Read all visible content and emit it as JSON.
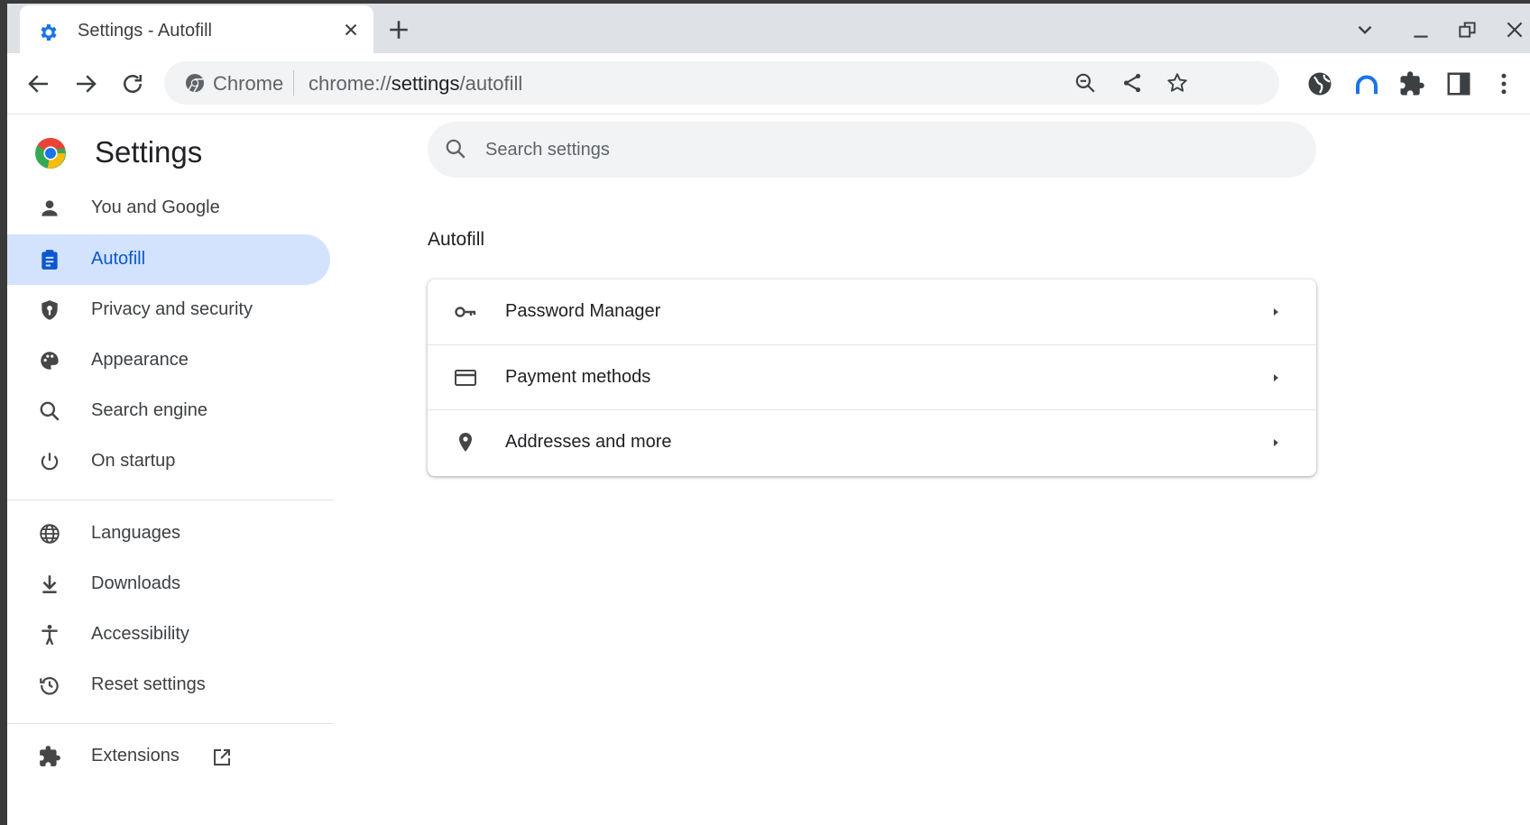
{
  "browser": {
    "tab_title": "Settings - Autofill",
    "omnibox": {
      "chip_label": "Chrome",
      "url_scheme": "chrome://",
      "url_host": "settings",
      "url_path": "/autofill"
    }
  },
  "sidebar": {
    "title": "Settings",
    "items": [
      {
        "label": "You and Google",
        "icon": "person-icon"
      },
      {
        "label": "Autofill",
        "icon": "clipboard-icon",
        "active": true
      },
      {
        "label": "Privacy and security",
        "icon": "shield-icon"
      },
      {
        "label": "Appearance",
        "icon": "palette-icon"
      },
      {
        "label": "Search engine",
        "icon": "search-icon"
      },
      {
        "label": "On startup",
        "icon": "power-icon"
      },
      {
        "label": "Languages",
        "icon": "globe-icon"
      },
      {
        "label": "Downloads",
        "icon": "download-icon"
      },
      {
        "label": "Accessibility",
        "icon": "accessibility-icon"
      },
      {
        "label": "Reset settings",
        "icon": "history-icon"
      },
      {
        "label": "Extensions",
        "icon": "puzzle-icon"
      }
    ]
  },
  "main": {
    "search_placeholder": "Search settings",
    "section_title": "Autofill",
    "rows": [
      {
        "label": "Password Manager",
        "icon": "key-icon"
      },
      {
        "label": "Payment methods",
        "icon": "credit-card-icon"
      },
      {
        "label": "Addresses and more",
        "icon": "location-pin-icon"
      }
    ]
  },
  "colors": {
    "accent": "#0b57d0",
    "active_bg": "#d3e3fd",
    "tab_strip": "#dee1e6"
  }
}
